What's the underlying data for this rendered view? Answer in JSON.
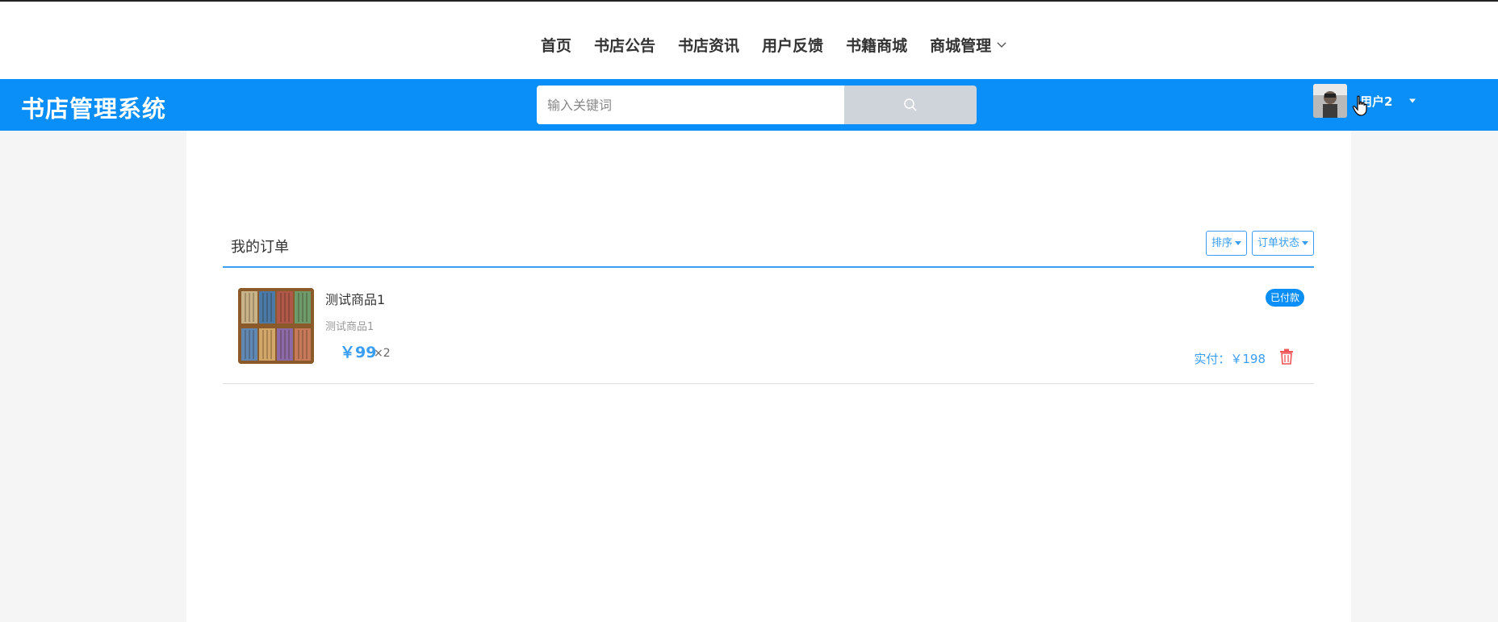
{
  "nav": {
    "items": [
      "首页",
      "书店公告",
      "书店资讯",
      "用户反馈",
      "书籍商城",
      "商城管理"
    ]
  },
  "header": {
    "logo": "书店管理系统",
    "search_placeholder": "输入关键词",
    "username": "用户2"
  },
  "orders": {
    "title": "我的订单",
    "sort_label": "排序",
    "status_filter_label": "订单状态",
    "items": [
      {
        "name": "测试商品1",
        "subtitle": "测试商品1",
        "price": "￥99",
        "quantity": "×2",
        "status": "已付款",
        "paid_label": "实付：",
        "paid_value": "￥198"
      }
    ]
  },
  "icons": {
    "search": "search-icon",
    "dropdown": "chevron-down-icon",
    "delete": "trash-icon"
  },
  "colors": {
    "primary": "#0a8ef8",
    "accent": "#3a9ef5",
    "delete": "#f05454"
  }
}
